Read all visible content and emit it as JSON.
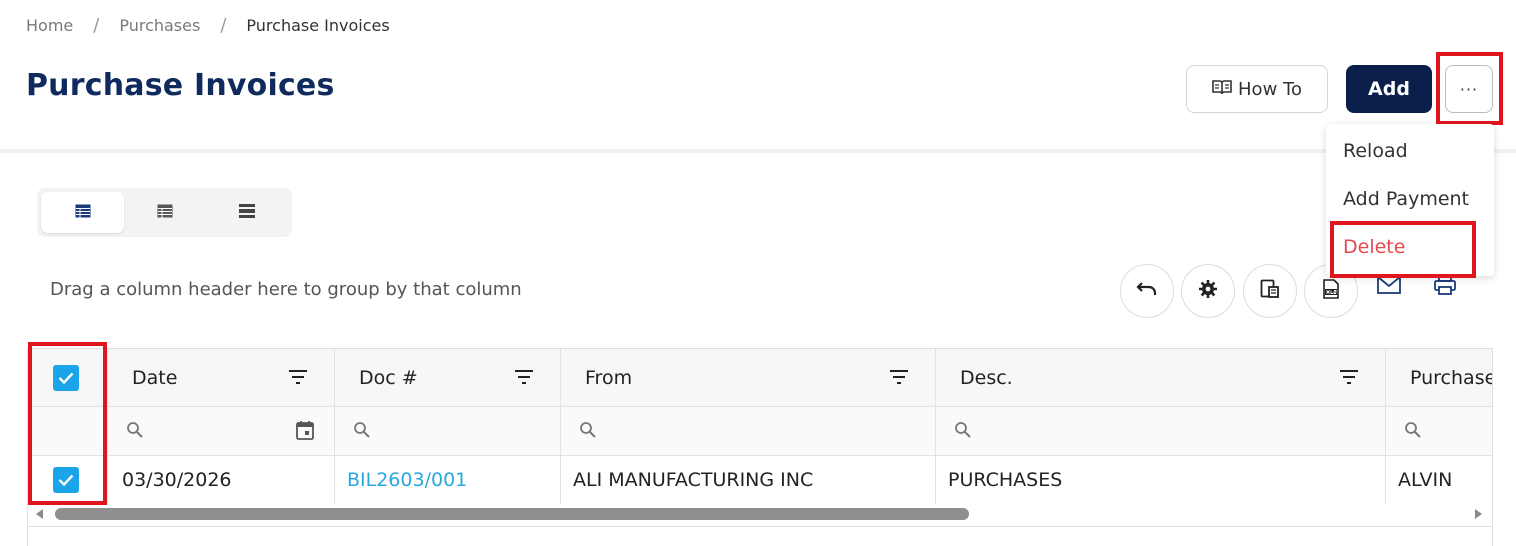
{
  "breadcrumb": {
    "home": "Home",
    "purchases": "Purchases",
    "current": "Purchase Invoices",
    "separator": "/"
  },
  "page": {
    "title": "Purchase Invoices"
  },
  "toolbar": {
    "howto_label": "How To",
    "add_label": "Add",
    "more_label": "···"
  },
  "menu": {
    "reload": "Reload",
    "add_payment": "Add Payment",
    "delete": "Delete"
  },
  "grid": {
    "group_hint": "Drag a column header here to group by that column",
    "columns": {
      "date": "Date",
      "doc": "Doc #",
      "from": "From",
      "desc": "Desc.",
      "purchaser": "Purchaser"
    },
    "row": {
      "date": "03/30/2026",
      "doc": "BIL2603/001",
      "from": "ALI MANUFACTURING INC",
      "desc": "PURCHASES",
      "purchaser": "ALVIN"
    }
  },
  "icons": {
    "view_modes": [
      "table-view-icon",
      "list-view-icon",
      "compact-view-icon"
    ],
    "tools": [
      "undo-icon",
      "gear-icon",
      "export-icon",
      "excel-icon",
      "mail-icon",
      "print-icon"
    ]
  },
  "colors": {
    "title": "#0f2a5c",
    "add_button": "#0b1f4b",
    "link": "#29a8e0",
    "checkbox": "#1aa4ea",
    "delete": "#e5484d",
    "highlight": "#e0161f"
  }
}
